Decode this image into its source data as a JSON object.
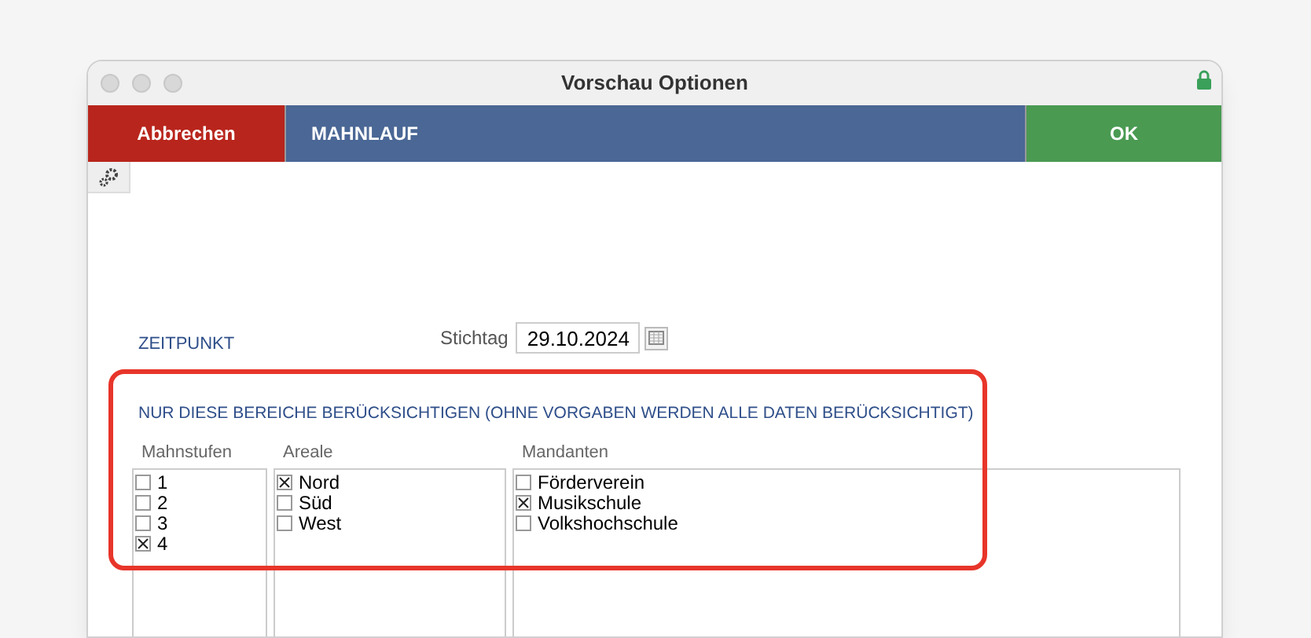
{
  "window": {
    "title": "Vorschau Optionen"
  },
  "toolbar": {
    "cancel": "Abbrechen",
    "title": "MAHNLAUF",
    "ok": "OK"
  },
  "zeitpunkt": {
    "heading": "ZEITPUNKT",
    "label": "Stichtag",
    "value": "29.10.2024"
  },
  "filter": {
    "heading": "NUR DIESE BEREICHE BERÜCKSICHTIGEN (OHNE VORGABEN WERDEN ALLE DATEN BERÜCKSICHTIGT)",
    "lists": [
      {
        "label": "Mahnstufen",
        "items": [
          {
            "text": "1",
            "checked": false
          },
          {
            "text": "2",
            "checked": false
          },
          {
            "text": "3",
            "checked": false
          },
          {
            "text": "4",
            "checked": true
          }
        ]
      },
      {
        "label": "Areale",
        "items": [
          {
            "text": "Nord",
            "checked": true
          },
          {
            "text": "Süd",
            "checked": false
          },
          {
            "text": "West",
            "checked": false
          }
        ]
      },
      {
        "label": "Mandanten",
        "items": [
          {
            "text": "Förderverein",
            "checked": false
          },
          {
            "text": "Musikschule",
            "checked": true
          },
          {
            "text": "Volkshochschule",
            "checked": false
          }
        ]
      }
    ]
  }
}
